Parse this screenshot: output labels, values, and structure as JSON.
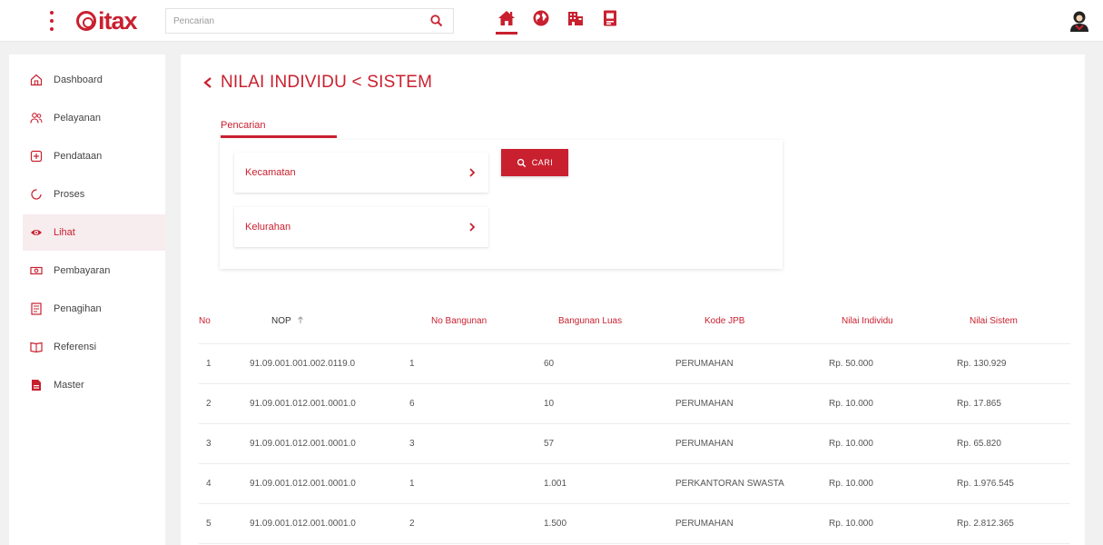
{
  "header": {
    "logo_text": "itax",
    "search": {
      "placeholder": "Pencarian",
      "value": ""
    },
    "nav_icons": [
      "home-icon",
      "globe-icon",
      "building-icon",
      "document-icon"
    ],
    "active_nav": "home-icon",
    "user_icon": "user-avatar-icon"
  },
  "sidebar": {
    "items": [
      {
        "label": "Dashboard",
        "icon": "home-outline-icon"
      },
      {
        "label": "Pelayanan",
        "icon": "users-icon"
      },
      {
        "label": "Pendataan",
        "icon": "add-box-icon"
      },
      {
        "label": "Proses",
        "icon": "loading-icon"
      },
      {
        "label": "Lihat",
        "icon": "eye-icon",
        "active": true
      },
      {
        "label": "Pembayaran",
        "icon": "money-icon"
      },
      {
        "label": "Penagihan",
        "icon": "invoice-icon"
      },
      {
        "label": "Referensi",
        "icon": "book-icon"
      },
      {
        "label": "Master",
        "icon": "file-icon"
      }
    ]
  },
  "main": {
    "title": "NILAI INDIVIDU < SISTEM",
    "tab_label": "Pencarian",
    "filters": {
      "kecamatan_label": "Kecamatan",
      "kelurahan_label": "Kelurahan",
      "search_button_label": "CARI"
    },
    "table": {
      "columns": [
        "No",
        "NOP",
        "No Bangunan",
        "Bangunan Luas",
        "Kode JPB",
        "Nilai Individu",
        "Nilai Sistem"
      ],
      "sorted_column": "NOP",
      "rows": [
        [
          "1",
          "91.09.001.001.002.0119.0",
          "1",
          "60",
          "PERUMAHAN",
          "Rp. 50.000",
          "Rp. 130.929"
        ],
        [
          "2",
          "91.09.001.012.001.0001.0",
          "6",
          "10",
          "PERUMAHAN",
          "Rp. 10.000",
          "Rp. 17.865"
        ],
        [
          "3",
          "91.09.001.012.001.0001.0",
          "3",
          "57",
          "PERUMAHAN",
          "Rp. 10.000",
          "Rp. 65.820"
        ],
        [
          "4",
          "91.09.001.012.001.0001.0",
          "1",
          "1.001",
          "PERKANTORAN SWASTA",
          "Rp. 10.000",
          "Rp. 1.976.545"
        ],
        [
          "5",
          "91.09.001.012.001.0001.0",
          "2",
          "1.500",
          "PERUMAHAN",
          "Rp. 10.000",
          "Rp. 2.812.365"
        ]
      ]
    }
  },
  "colors": {
    "brand": "#c9202f",
    "background": "#f1f1f1",
    "panel": "#ffffff",
    "active_sidebar_bg": "#f7ecee"
  }
}
